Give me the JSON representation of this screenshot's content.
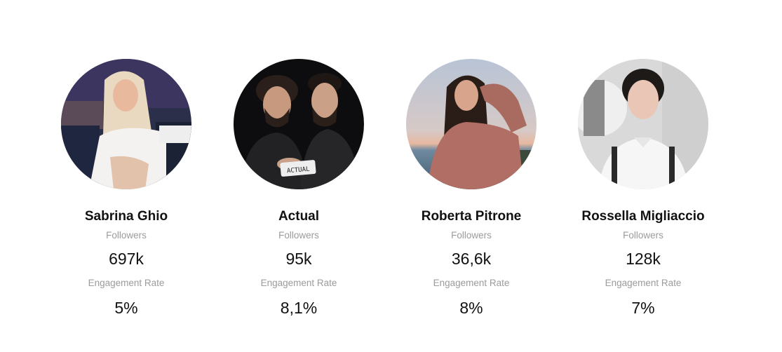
{
  "influencers": [
    {
      "name": "Sabrina Ghio",
      "followers_label": "Followers",
      "followers": "697k",
      "engagement_label": "Engagement Rate",
      "engagement": "5%"
    },
    {
      "name": "Actual",
      "followers_label": "Followers",
      "followers": "95k",
      "engagement_label": "Engagement Rate",
      "engagement": "8,1%",
      "avatar_text": "ACTUAL"
    },
    {
      "name": "Roberta Pitrone",
      "followers_label": "Followers",
      "followers": "36,6k",
      "engagement_label": "Engagement Rate",
      "engagement": "8%"
    },
    {
      "name": "Rossella Migliaccio",
      "followers_label": "Followers",
      "followers": "128k",
      "engagement_label": "Engagement Rate",
      "engagement": "7%"
    }
  ]
}
